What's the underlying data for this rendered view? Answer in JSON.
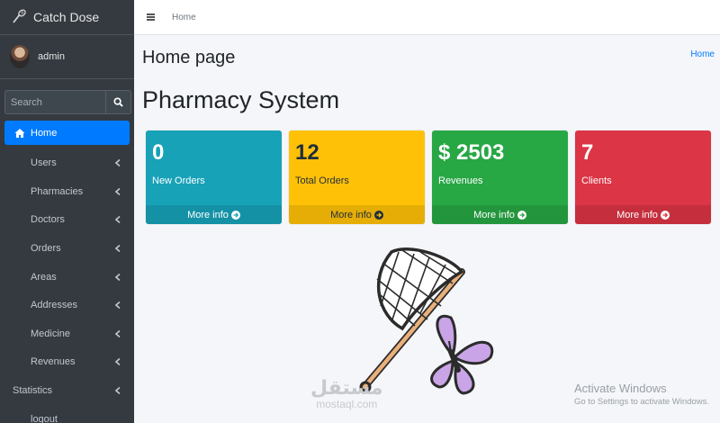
{
  "brand": {
    "name": "Catch Dose"
  },
  "user": {
    "name": "admin"
  },
  "search": {
    "placeholder": "Search"
  },
  "sidebar": {
    "items": [
      {
        "label": "Home"
      },
      {
        "label": "Users"
      },
      {
        "label": "Pharmacies"
      },
      {
        "label": "Doctors"
      },
      {
        "label": "Orders"
      },
      {
        "label": "Areas"
      },
      {
        "label": "Addresses"
      },
      {
        "label": "Medicine"
      },
      {
        "label": "Revenues"
      },
      {
        "label": "Statistics"
      },
      {
        "label": "logout"
      }
    ]
  },
  "topbar": {
    "home_link": "Home"
  },
  "page": {
    "title": "Home page",
    "breadcrumb": "Home",
    "heading": "Pharmacy System"
  },
  "boxes": [
    {
      "value": "0",
      "label": "New Orders",
      "footer": "More info",
      "color": "#17a2b8"
    },
    {
      "value": "12",
      "label": "Total Orders",
      "footer": "More info",
      "color": "#ffc107"
    },
    {
      "value": "$ 2503",
      "label": "Revenues",
      "footer": "More info",
      "color": "#28a745"
    },
    {
      "value": "7",
      "label": "Clients",
      "footer": "More info",
      "color": "#dc3545"
    }
  ],
  "watermark": {
    "title": "Activate Windows",
    "subtitle": "Go to Settings to activate Windows."
  },
  "site_watermark": {
    "arabic": "مستقل",
    "latin": "mostaql.com"
  },
  "icons": [
    "brand-logo-icon",
    "avatar",
    "search-icon",
    "home-icon",
    "chevron-left-icon",
    "hamburger-icon",
    "arrow-circle-right-icon",
    "butterfly-net-icon"
  ],
  "colors": {
    "sidebar": "#343a40",
    "active": "#007bff",
    "link": "#007bff"
  }
}
